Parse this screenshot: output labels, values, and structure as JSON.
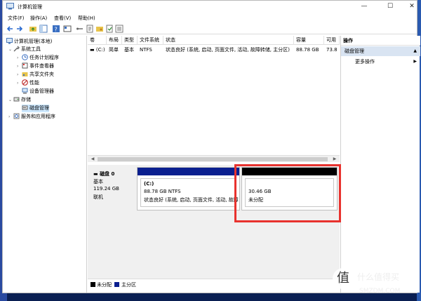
{
  "window": {
    "title": "计算机管理",
    "controls": {
      "minimize": "—",
      "maximize": "☐",
      "close": "✕"
    }
  },
  "menubar": [
    "文件(F)",
    "操作(A)",
    "查看(V)",
    "帮助(H)"
  ],
  "tree": {
    "root": "计算机管理(本地)",
    "system_tools": "系统工具",
    "task_scheduler": "任务计划程序",
    "event_viewer": "事件查看器",
    "shared_folders": "共享文件夹",
    "performance": "性能",
    "device_manager": "设备管理器",
    "storage": "存储",
    "disk_management": "磁盘管理",
    "services_apps": "服务和应用程序"
  },
  "volume_table": {
    "columns": [
      "卷",
      "布局",
      "类型",
      "文件系统",
      "状态",
      "容量",
      "可用"
    ],
    "rows": [
      {
        "volume": "(C:)",
        "layout": "简单",
        "type": "基本",
        "fs": "NTFS",
        "status": "状态良好 (系统, 启动, 页面文件, 活动, 故障转储, 主分区)",
        "capacity": "88.78 GB",
        "free": "73.8"
      }
    ]
  },
  "disk": {
    "name": "磁盘 0",
    "type": "基本",
    "size": "119.24 GB",
    "state": "联机",
    "partitions": [
      {
        "label": "(C:)",
        "size_fs": "88.78 GB NTFS",
        "status": "状态良好 (系统, 启动, 页面文件, 活动, 故障",
        "bar_color": "#0a1f8f"
      },
      {
        "label": "30.46 GB",
        "size_fs": "未分配",
        "status": "",
        "bar_color": "#000000"
      }
    ]
  },
  "legend": [
    {
      "label": "未分配",
      "color": "#000000"
    },
    {
      "label": "主分区",
      "color": "#0a1f8f"
    }
  ],
  "actions": {
    "header": "操作",
    "section": "磁盘管理",
    "more": "更多操作",
    "section_caret": "▲",
    "more_caret": "▶"
  },
  "scroll": {
    "left": "◀",
    "right": "▶"
  },
  "watermark": {
    "logo": "值",
    "text": "什么值得买",
    "site": "SMZDM.COM"
  }
}
